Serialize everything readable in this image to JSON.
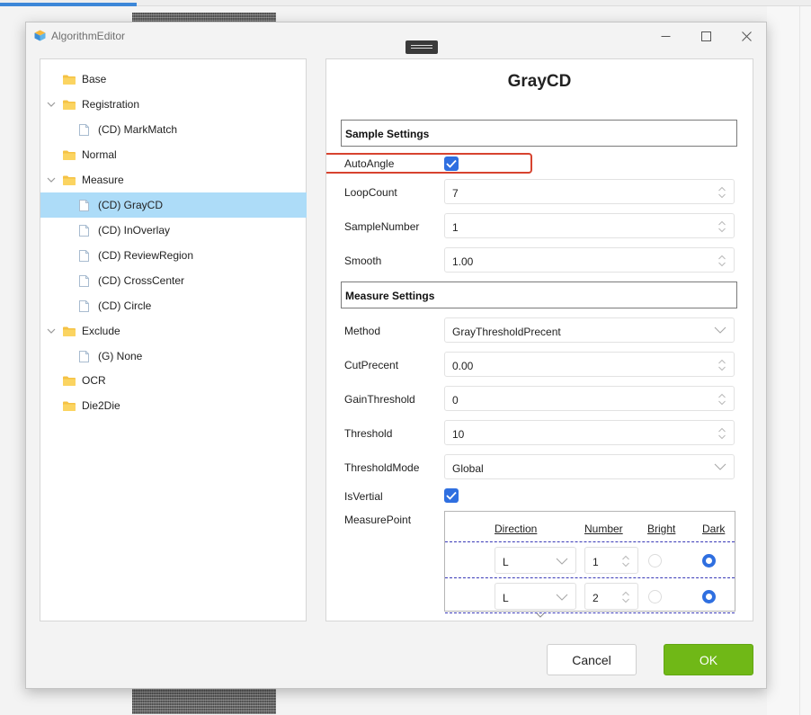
{
  "window": {
    "title": "AlgorithmEditor"
  },
  "tree": {
    "items": [
      {
        "label": "Base",
        "type": "folder",
        "level": 0,
        "expandable": false
      },
      {
        "label": "Registration",
        "type": "folder",
        "level": 0,
        "expandable": true
      },
      {
        "label": "(CD) MarkMatch",
        "type": "file",
        "level": 1
      },
      {
        "label": "Normal",
        "type": "folder",
        "level": 0,
        "expandable": false
      },
      {
        "label": "Measure",
        "type": "folder",
        "level": 0,
        "expandable": true
      },
      {
        "label": "(CD) GrayCD",
        "type": "file",
        "level": 1,
        "selected": true
      },
      {
        "label": "(CD) InOverlay",
        "type": "file",
        "level": 1
      },
      {
        "label": "(CD) ReviewRegion",
        "type": "file",
        "level": 1
      },
      {
        "label": "(CD) CrossCenter",
        "type": "file",
        "level": 1
      },
      {
        "label": "(CD) Circle",
        "type": "file",
        "level": 1
      },
      {
        "label": "Exclude",
        "type": "folder",
        "level": 0,
        "expandable": true
      },
      {
        "label": "(G) None",
        "type": "file",
        "level": 1
      },
      {
        "label": "OCR",
        "type": "folder",
        "level": 0,
        "expandable": false
      },
      {
        "label": "Die2Die",
        "type": "folder",
        "level": 0,
        "expandable": false
      }
    ]
  },
  "panel": {
    "title": "GrayCD",
    "sample_section": "Sample Settings",
    "measure_section": "Measure Settings",
    "auto_angle": {
      "label": "AutoAngle",
      "checked": true
    },
    "loop_count": {
      "label": "LoopCount",
      "value": "7"
    },
    "sample_number": {
      "label": "SampleNumber",
      "value": "1"
    },
    "smooth": {
      "label": "Smooth",
      "value": "1.00"
    },
    "method": {
      "label": "Method",
      "value": "GrayThresholdPrecent"
    },
    "cut_precent": {
      "label": "CutPrecent",
      "value": "0.00"
    },
    "gain_threshold": {
      "label": "GainThreshold",
      "value": "0"
    },
    "threshold": {
      "label": "Threshold",
      "value": "10"
    },
    "threshold_mode": {
      "label": "ThresholdMode",
      "value": "Global"
    },
    "is_vertial": {
      "label": "IsVertial",
      "checked": true
    },
    "measure_point": {
      "label": "MeasurePoint",
      "headers": {
        "direction": "Direction",
        "number": "Number",
        "bright": "Bright",
        "dark": "Dark"
      },
      "rows": [
        {
          "direction": "L",
          "number": "1",
          "bright": false,
          "dark": true
        },
        {
          "direction": "L",
          "number": "2",
          "bright": false,
          "dark": true
        }
      ]
    }
  },
  "buttons": {
    "cancel": "Cancel",
    "ok": "OK"
  },
  "colors": {
    "accent": "#2f6fe0",
    "ok": "#70b817",
    "selection": "#addcf8",
    "highlight": "#d7432f"
  }
}
